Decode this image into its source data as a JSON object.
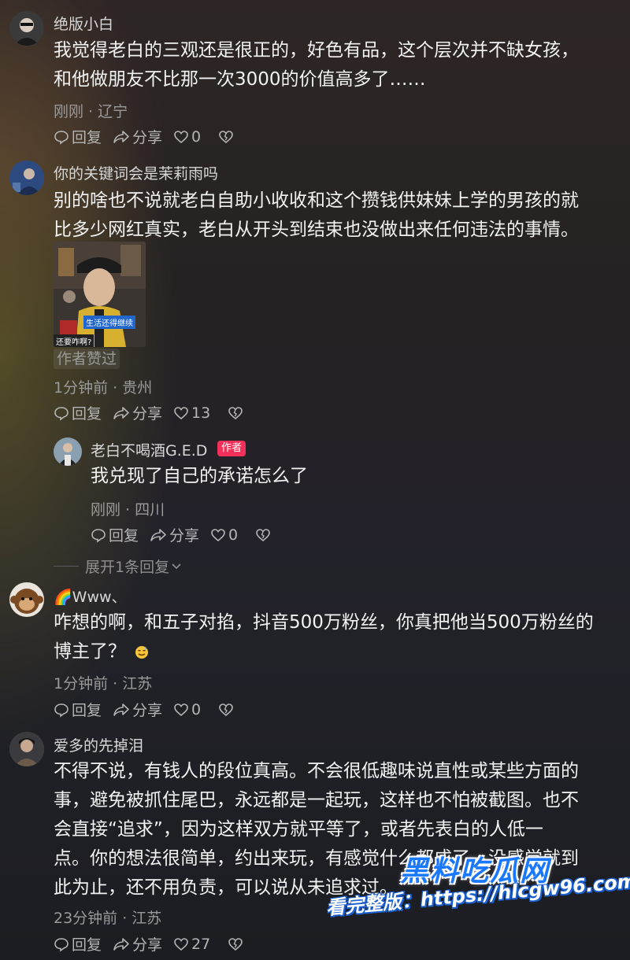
{
  "comments": [
    {
      "username": "绝版小白",
      "body_lines": [
        "我觉得老白的三观还是很正的，好色有品，这个层次并不缺女孩，",
        "和他做朋友不比那一次3000的价值高多了……"
      ],
      "meta": "刚刚 · 辽宁",
      "reply": "回复",
      "share": "分享",
      "likes": "0"
    },
    {
      "username": "你的关键词会是茉莉雨吗",
      "body_lines": [
        "别的啥也不说就老白自助小收收和这个攒钱供妹妹上学的男孩的就",
        "比多少网红真实，老白从开头到结束也没做出来任何违法的事情。"
      ],
      "image_caption_1": "生活还得继续",
      "image_caption_2": "还要咋啊?",
      "liked_tag": "作者赞过",
      "meta": "1分钟前 · 贵州",
      "reply": "回复",
      "share": "分享",
      "likes": "13"
    },
    {
      "username": "老白不喝酒G.E.D",
      "badge": "作者",
      "body_lines": [
        "我兑现了自己的承诺怎么了"
      ],
      "meta": "刚刚 · 四川",
      "reply": "回复",
      "share": "分享",
      "likes": "0"
    },
    {
      "username": "🌈Www、",
      "body_lines": [
        "咋想的啊，和五子对掐，抖音500万粉丝，你真把他当500万粉丝的",
        "博主了？"
      ],
      "meta": "1分钟前 · 江苏",
      "reply": "回复",
      "share": "分享",
      "likes": "0"
    },
    {
      "username": "爱多的先掉泪",
      "body_lines": [
        "不得不说，有钱人的段位真高。不会很低趣味说直性或某些方面的",
        "事，避免被抓住尾巴，永远都是一起玩，这样也不怕被截图。也不",
        "会直接“追求”，因为这样双方就平等了，或者先表白的人低一",
        "点。你的想法很简单，约出来玩，有感觉什么都成了，没感觉就到",
        "此为止，还不用负责，可以说从未追求过。"
      ],
      "meta": "23分钟前 · 江苏",
      "reply": "回复",
      "share": "分享",
      "likes": "27"
    }
  ],
  "expand_replies": "展开1条回复",
  "watermark": {
    "brand": "黑料吃瓜网",
    "prefix": "看完整版：",
    "url": "https://hlcgw96.com"
  },
  "colors": {
    "author_badge": "#f2305a",
    "watermark_blue": "#1a78ff"
  }
}
